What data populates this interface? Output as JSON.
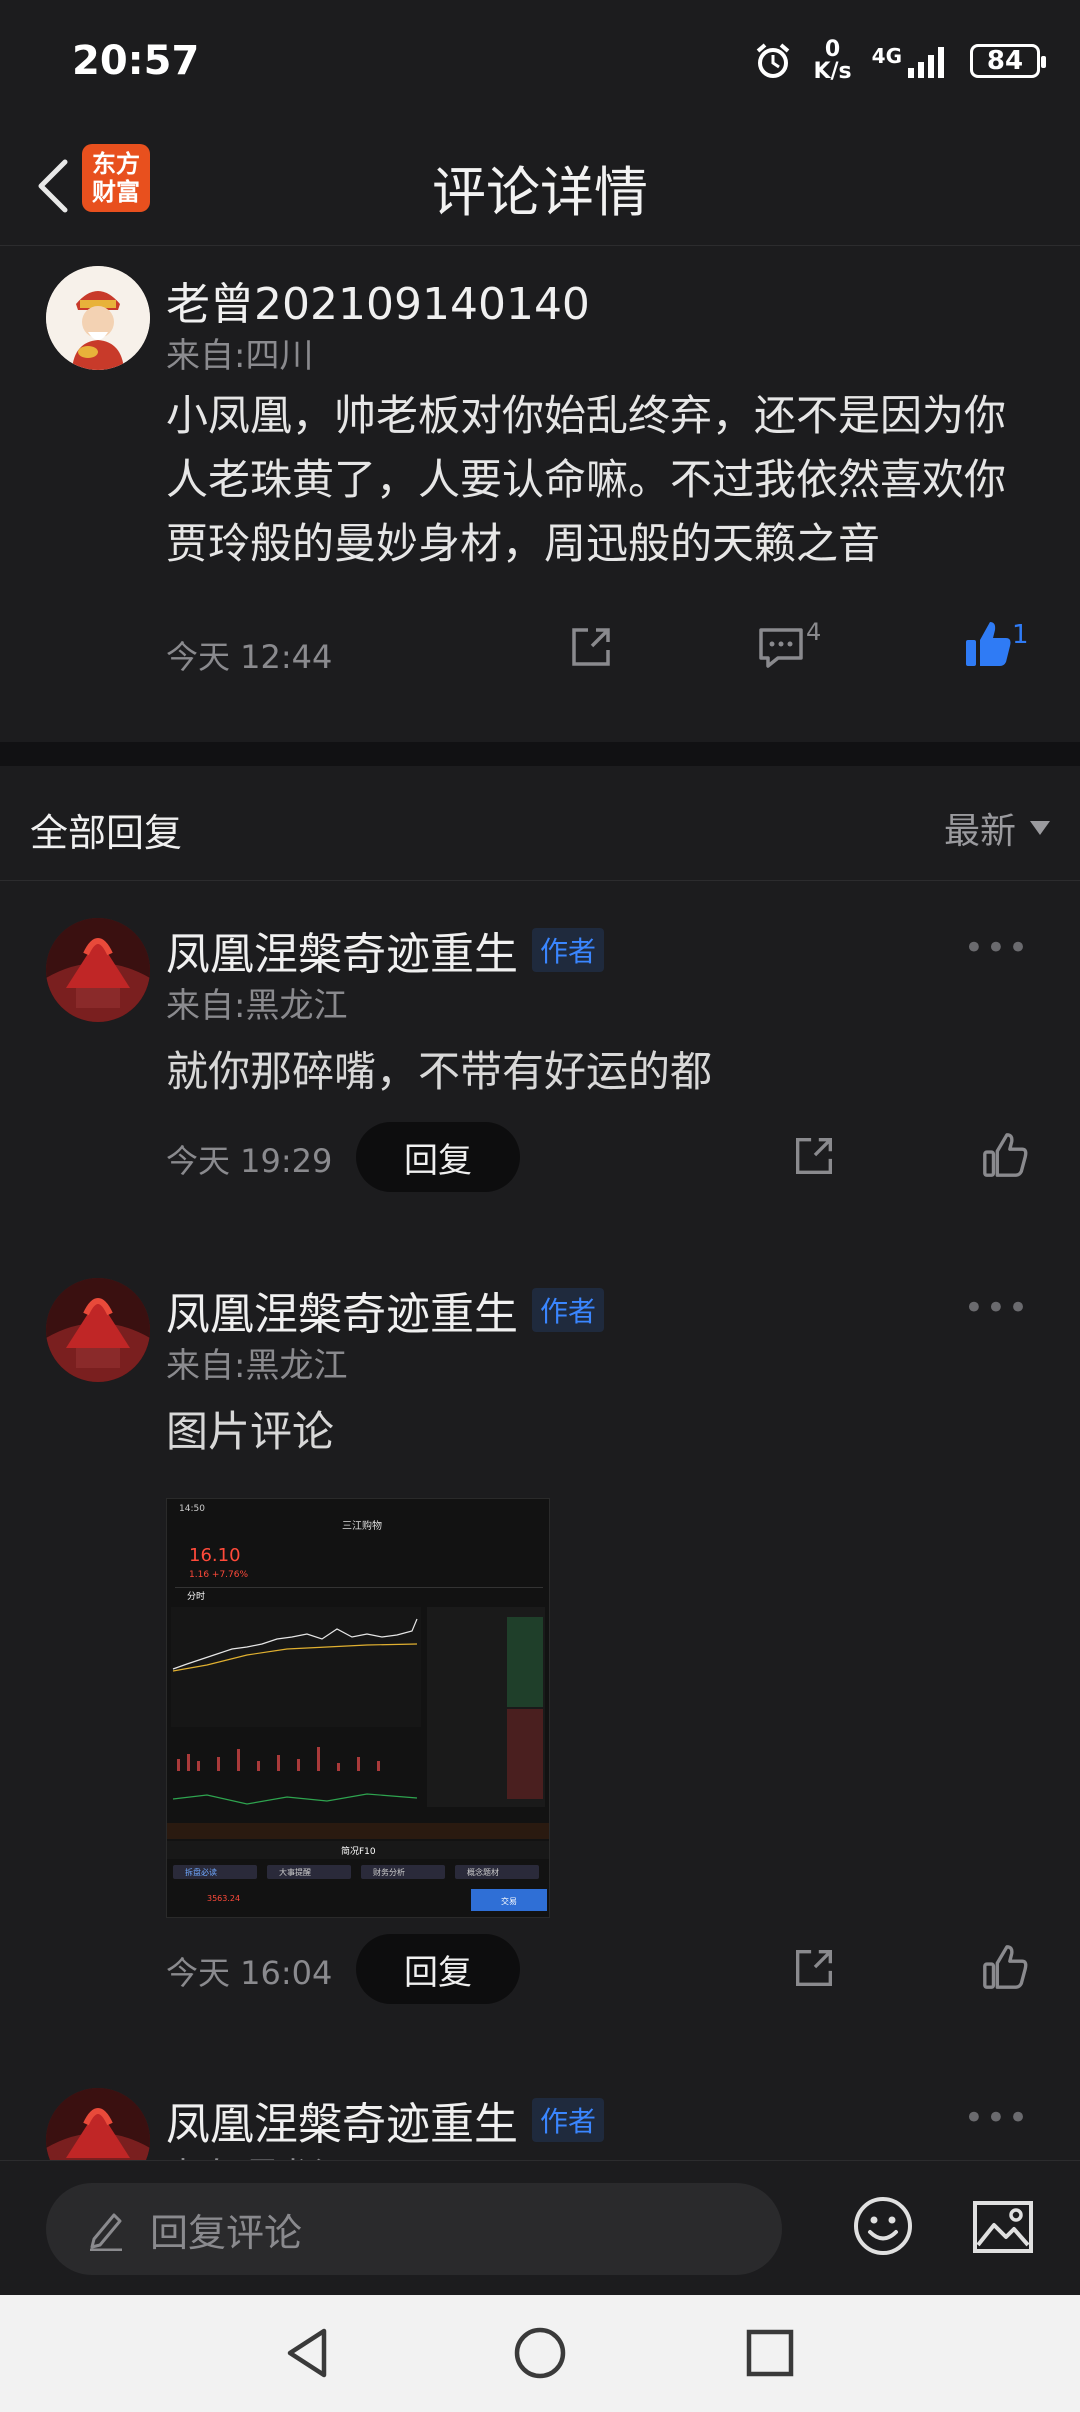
{
  "status_bar": {
    "time": "20:57",
    "net_speed_value": "0",
    "net_speed_unit": "K/s",
    "network": "4G",
    "battery": "84"
  },
  "header": {
    "logo_line1": "东方",
    "logo_line2": "财富",
    "title": "评论详情"
  },
  "main_comment": {
    "username": "老曾202109140140",
    "location": "来自:四川",
    "text": "小凤凰，帅老板对你始乱终弃，还不是因为你人老珠黄了，人要认命嘛。不过我依然喜欢你贾玲般的曼妙身材，周迅般的天籁之音",
    "time": "今天 12:44",
    "comment_count": "4",
    "like_count": "1",
    "like_color": "#2f7bf5"
  },
  "replies_header": {
    "title": "全部回复",
    "sort_label": "最新"
  },
  "replies": [
    {
      "username": "凤凰涅槃奇迹重生",
      "badge": "作者",
      "location": "来自:黑龙江",
      "text": "就你那碎嘴，不带有好运的都",
      "time": "今天 19:29",
      "reply_label": "回复"
    },
    {
      "username": "凤凰涅槃奇迹重生",
      "badge": "作者",
      "location": "来自:黑龙江",
      "text": "图片评论",
      "time": "今天 16:04",
      "reply_label": "回复",
      "image": {
        "status_time": "14:50",
        "stock_name": "三江购物",
        "price": "16.10",
        "change": "1.16 +7.76%",
        "tab_label": "分时",
        "section_label": "简况F10",
        "buttons": [
          "拆盘必读",
          "大事提醒",
          "财务分析",
          "概念题材"
        ],
        "trade_label": "交易",
        "index_value": "3563.24"
      }
    },
    {
      "username": "凤凰涅槃奇迹重生",
      "badge": "作者",
      "location": "来自:黑龙江"
    }
  ],
  "input_bar": {
    "placeholder": "回复评论"
  },
  "colors": {
    "background": "#1c1c1e",
    "accent_blue": "#2f7bf5",
    "logo_orange": "#e8501e"
  },
  "icons": [
    "back-icon",
    "share-icon",
    "comment-icon",
    "like-icon",
    "more-icon",
    "pencil-icon",
    "emoji-icon",
    "image-icon",
    "nav-back-icon",
    "nav-home-icon",
    "nav-recents-icon"
  ]
}
